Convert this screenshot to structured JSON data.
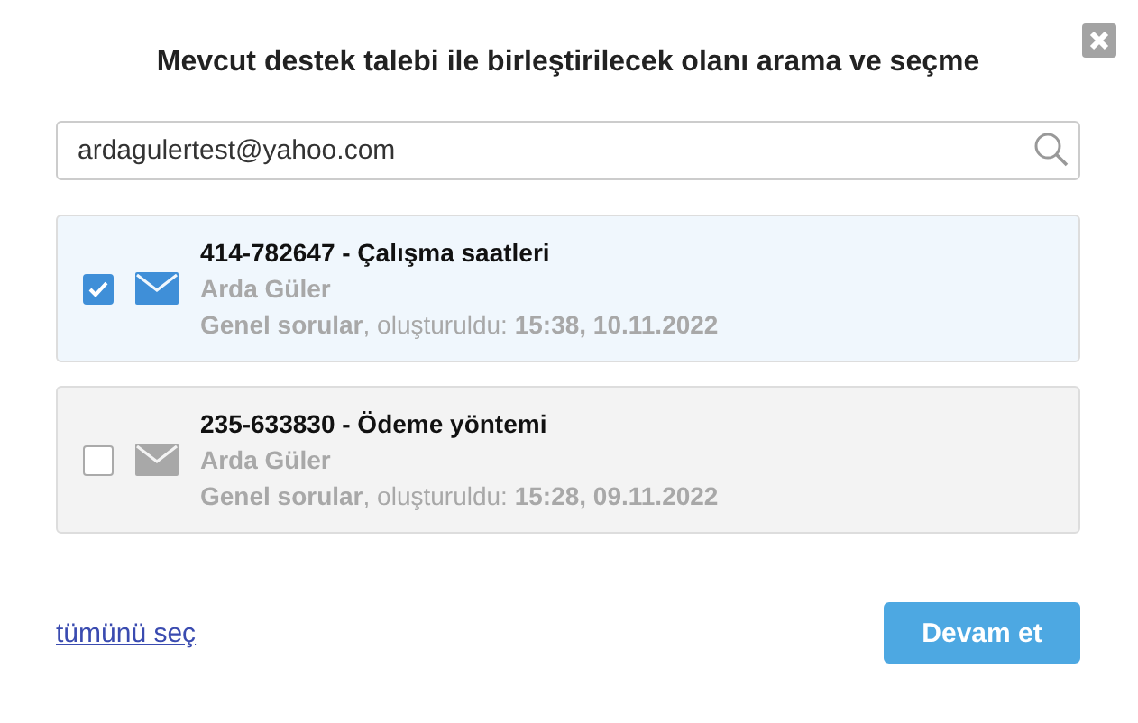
{
  "dialog": {
    "title": "Mevcut destek talebi ile birleştirilecek olanı arama ve seçme"
  },
  "search": {
    "value": "ardagulertest@yahoo.com"
  },
  "tickets": [
    {
      "title": "414-782647 - Çalışma saatleri",
      "requester": "Arda Güler",
      "meta": "**Genel sorular**, oluşturuldu: **15:38, 10.11.2022**",
      "selected": true
    },
    {
      "title": "235-633830 - Ödeme yöntemi",
      "requester": "Arda Güler",
      "meta": "**Genel sorular**, oluşturuldu: **15:28, 09.11.2022**",
      "selected": false
    }
  ],
  "footer": {
    "link": "tümünü seç",
    "button": "Devam et"
  }
}
